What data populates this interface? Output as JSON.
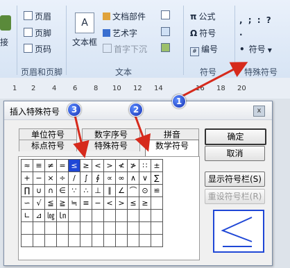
{
  "ribbon": {
    "header_group": {
      "items": [
        "页眉",
        "页脚",
        "页码"
      ],
      "label": "页眉和页脚"
    },
    "left_partial_label": "接",
    "text_group": {
      "textbox": "文本框",
      "doc_parts": "文档部件",
      "wordart": "艺术字",
      "dropcap": "首字下沉",
      "label": "文本"
    },
    "symbol_group": {
      "formula": "公式",
      "symbol": "符号",
      "numbering": "编号",
      "label": "符号"
    },
    "special_group": {
      "symbol": "符号",
      "label": "特殊符号",
      "punct_row1": ",  ;  :  ?",
      "punct_row2": ".",
      "bullet": "•"
    }
  },
  "ruler": {
    "numbers": [
      "1",
      "2",
      "4",
      "6",
      "8",
      "10",
      "12",
      "14",
      "16",
      "18",
      "20"
    ]
  },
  "dialog": {
    "title": "插入特殊符号",
    "close": "x",
    "tabs_back": [
      "单位符号",
      "数字序号",
      "拼音"
    ],
    "tabs_front": [
      "标点符号",
      "特殊符号",
      "数学符号"
    ],
    "grid": [
      [
        "≈",
        "≡",
        "≠",
        "=",
        "≤",
        "≥",
        "<",
        ">",
        "≮",
        "≯",
        "∷",
        "±"
      ],
      [
        "+",
        "−",
        "×",
        "÷",
        "/",
        "∫",
        "∮",
        "∝",
        "∞",
        "∧",
        "∨",
        "∑"
      ],
      [
        "∏",
        "∪",
        "∩",
        "∈",
        "∵",
        "∴",
        "⊥",
        "∥",
        "∠",
        "⌒",
        "⊙",
        "≌"
      ],
      [
        "∽",
        "√",
        "≦",
        "≧",
        "≒",
        "≡",
        "−",
        "<",
        ">",
        "≤",
        "≥",
        ""
      ],
      [
        "∟",
        "⊿",
        "㏒",
        "㏑",
        "",
        "",
        "",
        "",
        "",
        "",
        "",
        ""
      ],
      [
        "",
        "",
        "",
        "",
        "",
        "",
        "",
        "",
        "",
        "",
        "",
        ""
      ],
      [
        "",
        "",
        "",
        "",
        "",
        "",
        "",
        "",
        "",
        "",
        "",
        ""
      ]
    ],
    "ok": "确定",
    "cancel": "取消",
    "show_bar": "显示符号栏(S)",
    "reset_bar": "重设符号栏(R)",
    "preview_symbol": "≤"
  },
  "badges": [
    "1",
    "2",
    "3"
  ],
  "colors": {
    "accent": "#1f47d6",
    "arrow": "#d62a1c"
  }
}
